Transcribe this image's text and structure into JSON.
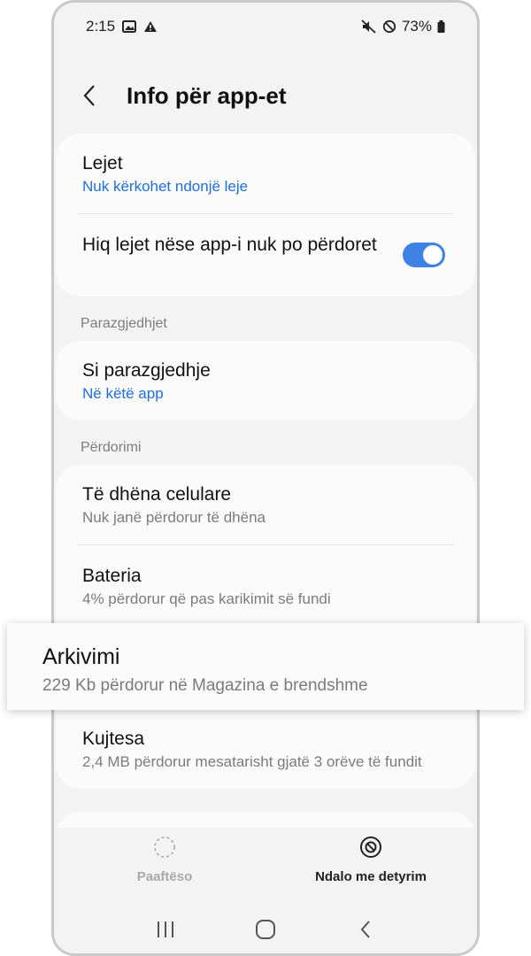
{
  "status_bar": {
    "time": "2:15",
    "battery": "73%"
  },
  "header": {
    "title": "Info për app-et"
  },
  "permissions": {
    "title": "Lejet",
    "subtitle": "Nuk kërkohet ndonjë leje",
    "remove_title": "Hiq lejet nëse app-i nuk po përdoret",
    "remove_enabled": true
  },
  "defaults": {
    "section_label": "Parazgjedhjet",
    "title": "Si parazgjedhje",
    "subtitle": "Në këtë app"
  },
  "usage": {
    "section_label": "Përdorimi",
    "mobile_data": {
      "title": "Të dhëna celulare",
      "subtitle": "Nuk janë përdorur të dhëna"
    },
    "battery": {
      "title": "Bateria",
      "subtitle": "4% përdorur që pas karikimit së fundi"
    },
    "storage": {
      "title": "Arkivimi",
      "subtitle": "229 Kb përdorur në Magazina e brendshme"
    },
    "memory": {
      "title": "Kujtesa",
      "subtitle": "2,4 MB përdorur mesatarisht gjatë 3 orëve të fundit"
    }
  },
  "actions": {
    "uninstall": "Paaftëso",
    "force_stop": "Ndalo me detyrim"
  },
  "colors": {
    "accent": "#3e82e6",
    "link": "#1e6fd9"
  }
}
